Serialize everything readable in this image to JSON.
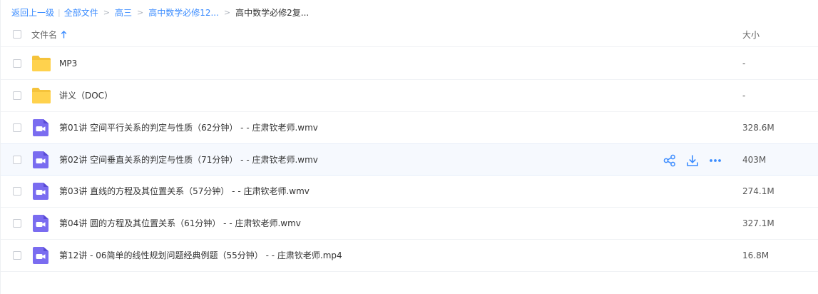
{
  "breadcrumb": {
    "back": "返回上一级",
    "all_files": "全部文件",
    "level1": "高三",
    "level2": "高中数学必修12...",
    "current": "高中数学必修2复..."
  },
  "header": {
    "name_label": "文件名",
    "size_label": "大小"
  },
  "colors": {
    "accent": "#3b8cff",
    "folder": "#ffd24d",
    "video": "#7a6cf0"
  },
  "files": [
    {
      "name": "MP3",
      "size": "-",
      "type": "folder"
    },
    {
      "name": "讲义（DOC）",
      "size": "-",
      "type": "folder"
    },
    {
      "name": "第01讲 空间平行关系的判定与性质（62分钟） - - 庄肃钦老师.wmv",
      "size": "328.6M",
      "type": "video"
    },
    {
      "name": "第02讲 空间垂直关系的判定与性质（71分钟） - - 庄肃钦老师.wmv",
      "size": "403M",
      "type": "video"
    },
    {
      "name": "第03讲 直线的方程及其位置关系（57分钟） - - 庄肃钦老师.wmv",
      "size": "274.1M",
      "type": "video"
    },
    {
      "name": "第04讲 圆的方程及其位置关系（61分钟） - - 庄肃钦老师.wmv",
      "size": "327.1M",
      "type": "video"
    },
    {
      "name": "第12讲 - 06简单的线性规划问题经典例题（55分钟） - - 庄肃钦老师.mp4",
      "size": "16.8M",
      "type": "video"
    }
  ],
  "row_actions": [
    "share-icon",
    "download-icon",
    "more-icon"
  ]
}
